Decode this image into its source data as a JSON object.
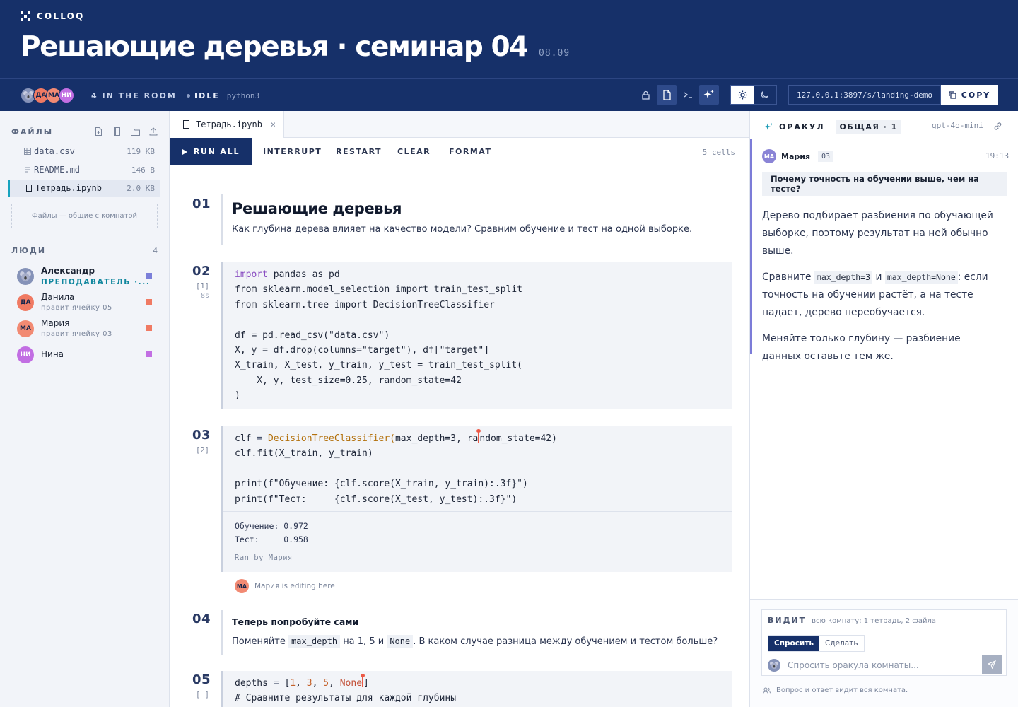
{
  "app": {
    "brand": "COLLOQ",
    "title": "Решающие деревья · семинар 04",
    "date": "08.09"
  },
  "room": {
    "avatars": [
      "ДА",
      "МА",
      "НИ"
    ],
    "count_label": "4 IN THE ROOM",
    "kernel_status": "IDLE",
    "kernel_name": "python3",
    "url": "127.0.0.1:3897/s/landing-demo",
    "copy_label": "COPY"
  },
  "sidebar": {
    "files_title": "ФАЙЛЫ",
    "files": [
      {
        "name": "data.csv",
        "size": "119 KB",
        "icon": "table-icon"
      },
      {
        "name": "README.md",
        "size": "146 B",
        "icon": "text-file-icon"
      },
      {
        "name": "Тетрадь.ipynb",
        "size": "2.0 KB",
        "icon": "notebook-icon",
        "active": true
      }
    ],
    "files_note": "Файлы — общие с комнатой",
    "people_title": "ЛЮДИ",
    "people_count": "4",
    "people": [
      {
        "initials": "",
        "name": "Александр",
        "sub": "ПРЕПОДАВАТЕЛЬ ·...",
        "color": "#7b7fd9"
      },
      {
        "initials": "ДА",
        "name": "Данила",
        "sub": "правит ячейку 05",
        "color": "#f07a63"
      },
      {
        "initials": "МА",
        "name": "Мария",
        "sub": "правит ячейку 03",
        "color": "#f07a63"
      },
      {
        "initials": "НИ",
        "name": "Нина",
        "sub": "",
        "color": "#c26ee3"
      }
    ]
  },
  "notebook": {
    "tab_label": "Тетрадь.ipynb",
    "toolbar": {
      "run_all": "RUN ALL",
      "interrupt": "INTERRUPT",
      "restart": "RESTART",
      "clear": "CLEAR",
      "format": "FORMAT",
      "cells_count": "5 cells"
    },
    "cells": {
      "c1": {
        "num": "01",
        "title": "Решающие деревья",
        "text": "Как глубина дерева влияет на качество модели? Сравним обучение и тест на одной выборке."
      },
      "c2": {
        "num": "02",
        "count": "[1]",
        "time": "8s"
      },
      "c3": {
        "num": "03",
        "count": "[2]",
        "output_line1": "Обучение: 0.972",
        "output_line2": "Тест:     0.958",
        "ran_by": "Ran by Мария",
        "editing_initials": "МА",
        "editing_text": "Мария is editing here"
      },
      "c4": {
        "num": "04",
        "title": "Теперь попробуйте сами",
        "text_a": "Поменяйте",
        "code_a": "max_depth",
        "text_b": "на 1, 5 и",
        "code_b": "None",
        "text_c": ". В каком случае разница между обучением и тестом больше?"
      },
      "c5": {
        "num": "05",
        "count": "[ ]",
        "comment": "# Сравните результаты для каждой глубины"
      }
    }
  },
  "oracle": {
    "title": "ОРАКУЛ",
    "badge": "ОБЩАЯ · 1",
    "model": "gpt-4o-mini",
    "question": {
      "initials": "МА",
      "name": "Мария",
      "cell": "03",
      "time": "19:13",
      "text": "Почему точность на обучении выше, чем на тесте?"
    },
    "answer": {
      "p1": "Дерево подбирает разбиения по обучающей выборке, поэтому результат на ней обычно выше.",
      "p2_a": "Сравните",
      "p2_code1": "max_depth=3",
      "p2_b": "и",
      "p2_code2": "max_depth=None",
      "p2_c": ": если точность на обучении растёт, а на тесте падает, дерево переобучается.",
      "p3": "Меняйте только глубину — разбиение данных оставьте тем же."
    },
    "compose": {
      "sees_label": "ВИДИТ",
      "sees_text": "всю комнату: 1 тетрадь, 2 файла",
      "mode_ask": "Спросить",
      "mode_do": "Сделать",
      "placeholder": "Спросить оракула комнаты...",
      "visible_note": "Вопрос и ответ видит вся комната."
    }
  }
}
